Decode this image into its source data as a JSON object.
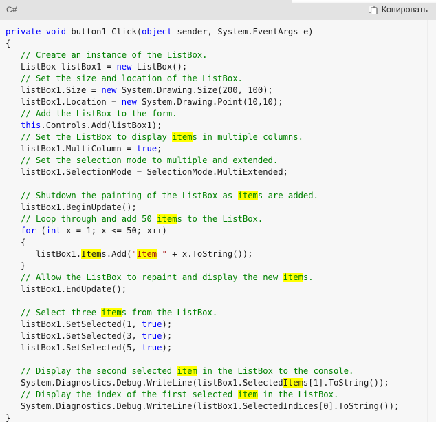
{
  "header": {
    "language_label": "C#",
    "copy_label": "Копировать",
    "copy_icon": "copy-pages-icon",
    "background_color": "#e3e3e3"
  },
  "theme": {
    "code_background": "#f7f7f7",
    "plain_color": "#1b1b1b",
    "keyword_color": "#0000ff",
    "comment_color": "#008000",
    "string_color": "#a31515",
    "highlight_color": "#ffff00"
  },
  "code": {
    "language": "csharp",
    "search_term": "item",
    "lines": [
      [
        {
          "t": "private",
          "c": "kw"
        },
        {
          "t": " ",
          "c": "pl"
        },
        {
          "t": "void",
          "c": "kw"
        },
        {
          "t": " button1_Click(",
          "c": "pl"
        },
        {
          "t": "object",
          "c": "kw"
        },
        {
          "t": " sender, System.EventArgs e)",
          "c": "pl"
        }
      ],
      [
        {
          "t": "{",
          "c": "pl"
        }
      ],
      [
        {
          "t": "   ",
          "c": "pl"
        },
        {
          "t": "// Create an instance of the ListBox.",
          "c": "cm"
        }
      ],
      [
        {
          "t": "   ListBox listBox1 = ",
          "c": "pl"
        },
        {
          "t": "new",
          "c": "kw"
        },
        {
          "t": " ListBox();",
          "c": "pl"
        }
      ],
      [
        {
          "t": "   ",
          "c": "pl"
        },
        {
          "t": "// Set the size and location of the ListBox.",
          "c": "cm"
        }
      ],
      [
        {
          "t": "   listBox1.Size = ",
          "c": "pl"
        },
        {
          "t": "new",
          "c": "kw"
        },
        {
          "t": " System.Drawing.Size(200, 100);",
          "c": "pl"
        }
      ],
      [
        {
          "t": "   listBox1.Location = ",
          "c": "pl"
        },
        {
          "t": "new",
          "c": "kw"
        },
        {
          "t": " System.Drawing.Point(10,10);",
          "c": "pl"
        }
      ],
      [
        {
          "t": "   ",
          "c": "pl"
        },
        {
          "t": "// Add the ListBox to the form.",
          "c": "cm"
        }
      ],
      [
        {
          "t": "   ",
          "c": "pl"
        },
        {
          "t": "this",
          "c": "kw"
        },
        {
          "t": ".Controls.Add(listBox1);",
          "c": "pl"
        }
      ],
      [
        {
          "t": "   ",
          "c": "pl"
        },
        {
          "t": "// Set the ListBox to display ",
          "c": "cm"
        },
        {
          "t": "item",
          "c": "cm",
          "h": true
        },
        {
          "t": "s in multiple columns.",
          "c": "cm"
        }
      ],
      [
        {
          "t": "   listBox1.MultiColumn = ",
          "c": "pl"
        },
        {
          "t": "true",
          "c": "kw"
        },
        {
          "t": ";",
          "c": "pl"
        }
      ],
      [
        {
          "t": "   ",
          "c": "pl"
        },
        {
          "t": "// Set the selection mode to multiple and extended.",
          "c": "cm"
        }
      ],
      [
        {
          "t": "   listBox1.SelectionMode = SelectionMode.MultiExtended;",
          "c": "pl"
        }
      ],
      [],
      [
        {
          "t": "   ",
          "c": "pl"
        },
        {
          "t": "// Shutdown the painting of the ListBox as ",
          "c": "cm"
        },
        {
          "t": "item",
          "c": "cm",
          "h": true
        },
        {
          "t": "s are added.",
          "c": "cm"
        }
      ],
      [
        {
          "t": "   listBox1.BeginUpdate();",
          "c": "pl"
        }
      ],
      [
        {
          "t": "   ",
          "c": "pl"
        },
        {
          "t": "// Loop through and add 50 ",
          "c": "cm"
        },
        {
          "t": "item",
          "c": "cm",
          "h": true
        },
        {
          "t": "s to the ListBox.",
          "c": "cm"
        }
      ],
      [
        {
          "t": "   ",
          "c": "pl"
        },
        {
          "t": "for",
          "c": "kw"
        },
        {
          "t": " (",
          "c": "pl"
        },
        {
          "t": "int",
          "c": "kw"
        },
        {
          "t": " x = 1; x <= 50; x++)",
          "c": "pl"
        }
      ],
      [
        {
          "t": "   {",
          "c": "pl"
        }
      ],
      [
        {
          "t": "      listBox1.",
          "c": "pl"
        },
        {
          "t": "Item",
          "c": "pl",
          "h": true
        },
        {
          "t": "s.Add(",
          "c": "pl"
        },
        {
          "t": "\"",
          "c": "str"
        },
        {
          "t": "Item",
          "c": "str",
          "h": true
        },
        {
          "t": " \"",
          "c": "str"
        },
        {
          "t": " + x.ToString());",
          "c": "pl"
        }
      ],
      [
        {
          "t": "   }",
          "c": "pl"
        }
      ],
      [
        {
          "t": "   ",
          "c": "pl"
        },
        {
          "t": "// Allow the ListBox to repaint and display the new ",
          "c": "cm"
        },
        {
          "t": "item",
          "c": "cm",
          "h": true
        },
        {
          "t": "s.",
          "c": "cm"
        }
      ],
      [
        {
          "t": "   listBox1.EndUpdate();",
          "c": "pl"
        }
      ],
      [],
      [
        {
          "t": "   ",
          "c": "pl"
        },
        {
          "t": "// Select three ",
          "c": "cm"
        },
        {
          "t": "item",
          "c": "cm",
          "h": true
        },
        {
          "t": "s from the ListBox.",
          "c": "cm"
        }
      ],
      [
        {
          "t": "   listBox1.SetSelected(1, ",
          "c": "pl"
        },
        {
          "t": "true",
          "c": "kw"
        },
        {
          "t": ");",
          "c": "pl"
        }
      ],
      [
        {
          "t": "   listBox1.SetSelected(3, ",
          "c": "pl"
        },
        {
          "t": "true",
          "c": "kw"
        },
        {
          "t": ");",
          "c": "pl"
        }
      ],
      [
        {
          "t": "   listBox1.SetSelected(5, ",
          "c": "pl"
        },
        {
          "t": "true",
          "c": "kw"
        },
        {
          "t": ");",
          "c": "pl"
        }
      ],
      [],
      [
        {
          "t": "   ",
          "c": "pl"
        },
        {
          "t": "// Display the second selected ",
          "c": "cm"
        },
        {
          "t": "item",
          "c": "cm",
          "h": true
        },
        {
          "t": " in the ListBox to the console.",
          "c": "cm"
        }
      ],
      [
        {
          "t": "   System.Diagnostics.Debug.WriteLine(listBox1.Selected",
          "c": "pl"
        },
        {
          "t": "Item",
          "c": "pl",
          "h": true
        },
        {
          "t": "s[1].ToString());",
          "c": "pl"
        }
      ],
      [
        {
          "t": "   ",
          "c": "pl"
        },
        {
          "t": "// Display the index of the first selected ",
          "c": "cm"
        },
        {
          "t": "item",
          "c": "cm",
          "h": true
        },
        {
          "t": " in the ListBox.",
          "c": "cm"
        }
      ],
      [
        {
          "t": "   System.Diagnostics.Debug.WriteLine(listBox1.SelectedIndices[0].ToString());",
          "c": "pl"
        }
      ],
      [
        {
          "t": "}",
          "c": "pl"
        }
      ]
    ]
  }
}
